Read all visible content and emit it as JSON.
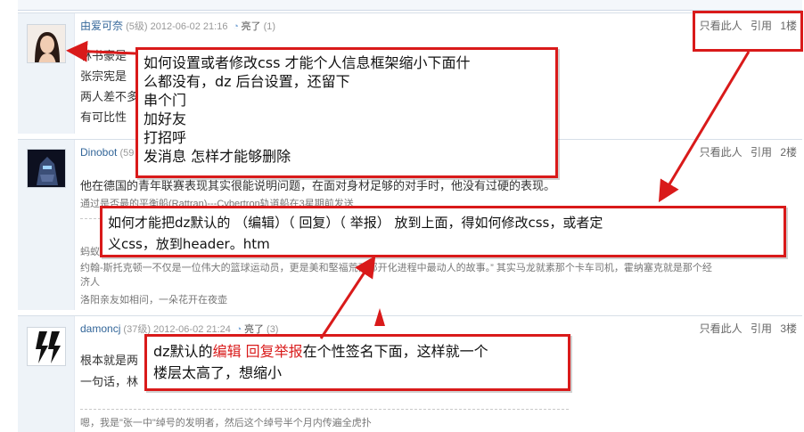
{
  "posts": [
    {
      "author": "由爱可奈",
      "level": "(5级)",
      "time": "2012-06-02 21:16",
      "liked_label": "亮了",
      "liked_count": "(1)",
      "ops": [
        "只看此人",
        "引用",
        "1楼"
      ],
      "lines": [
        "林书豪是",
        "张宗宪是",
        "两人差不多",
        "有可比性"
      ],
      "signature": []
    },
    {
      "author": "Dinobot",
      "level": "(59",
      "time": "",
      "liked_label": "",
      "liked_count": "",
      "ops": [
        "只看此人",
        "引用",
        "2楼"
      ],
      "lines": [
        "他在德国的青年联赛表现其实很能说明问题，在面对身材足够的对手时，他没有过硬的表现。"
      ],
      "signature": [
        "通过是否最的平衡船(Rattran)---Cybertron轨道船在3星期前发送",
        "蚂蚁",
        "约翰-斯托克顿一不仅是一位伟大的篮球运动员，更是美和堅福荒西部开化进程中最动人的故事。” 其实马龙就素那个卡车司机，霍纳塞克就是那个经",
        "济人",
        "洛阳亲友如相问，一朵花开在夜壶"
      ]
    },
    {
      "author": "damoncj",
      "level": "(37级)",
      "time": "2012-06-02 21:24",
      "liked_label": "亮了",
      "liked_count": "(3)",
      "ops": [
        "只看此人",
        "引用",
        "3楼"
      ],
      "lines": [
        "根本就是两",
        "一句话，林"
      ],
      "signature": [
        "嗯，我是\"张一中\"绰号的发明者，然后这个绰号半个月内传遍全虎扑"
      ]
    }
  ],
  "callouts": {
    "c1": [
      "如何设置或者修改css 才能个人信息框架缩小下面什",
      "么都没有，dz 后台设置，还留下",
      "串个门",
      "加好友",
      "打招呼",
      "发消息   怎样才能够删除"
    ],
    "c2": [
      "如何才能把dz默认的 （编辑）（ 回复）（ 举报） 放到上面，得如何修改css，或者定",
      "义css，放到header。htm"
    ],
    "c3": {
      "pre": "dz默认的",
      "red": "编辑 回复举报",
      "post": "在个性签名下面，这样就一个",
      "line2": "楼层太高了，想缩小"
    }
  },
  "colors": {
    "accent_red": "#d91a1a",
    "author_link": "#336699",
    "sidebar": "#eef3f8"
  }
}
